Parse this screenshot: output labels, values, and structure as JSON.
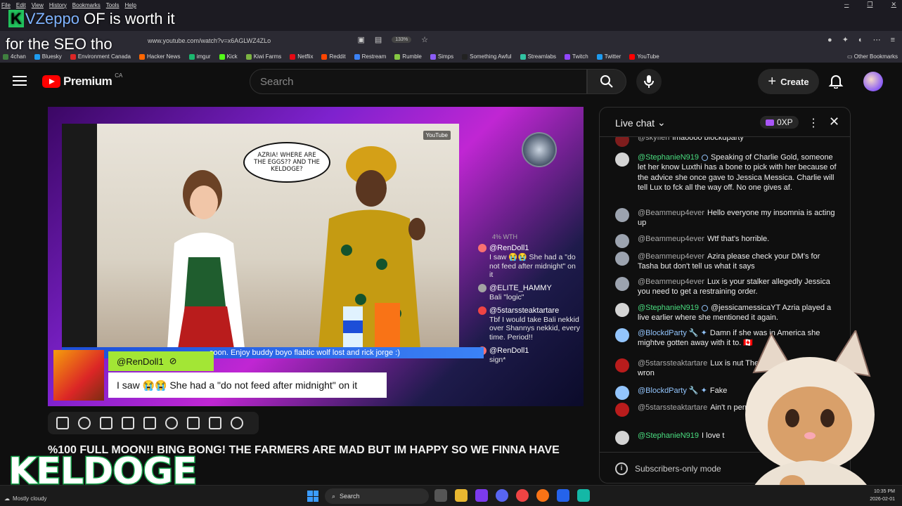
{
  "browser": {
    "menu": [
      "File",
      "Edit",
      "View",
      "History",
      "Bookmarks",
      "Tools",
      "Help"
    ],
    "url": "www.youtube.com/watch?v=x6AGLWZ4ZLo",
    "zoom": "133%",
    "bookmarks": [
      {
        "label": "4chan",
        "color": "#3f7f3f"
      },
      {
        "label": "Bluesky",
        "color": "#1d9bf0"
      },
      {
        "label": "Environment Canada",
        "color": "#dc2626"
      },
      {
        "label": "Hacker News",
        "color": "#ff6600"
      },
      {
        "label": "imgur",
        "color": "#1bb76e"
      },
      {
        "label": "Kick",
        "color": "#53fc18"
      },
      {
        "label": "Kiwi Farms",
        "color": "#7cb342"
      },
      {
        "label": "Netflix",
        "color": "#e50914"
      },
      {
        "label": "Reddit",
        "color": "#ff4500"
      },
      {
        "label": "Restream",
        "color": "#3b82f6"
      },
      {
        "label": "Rumble",
        "color": "#85c742"
      },
      {
        "label": "Simps",
        "color": "#8b5cf6"
      },
      {
        "label": "Something Awful",
        "color": "#222222"
      },
      {
        "label": "Streamlabs",
        "color": "#31c3a2"
      },
      {
        "label": "Twitch",
        "color": "#9146ff"
      },
      {
        "label": "Twitter",
        "color": "#1d9bf0"
      },
      {
        "label": "YouTube",
        "color": "#ff0000"
      }
    ],
    "other_bookmarks": "Other Bookmarks"
  },
  "overlay": {
    "line1_brand": "VZeppo",
    "line1_rest": "OF is worth it",
    "line2": "for the SEO tho",
    "keldoge": "KELDOGE"
  },
  "header": {
    "brand": "Premium",
    "region": "CA",
    "search_placeholder": "Search",
    "create_label": "Create"
  },
  "video": {
    "bubble": "AZRIA! WHERE ARE THE EGGS?? AND THE KELDOGE?",
    "watermark": "YouTube",
    "ticker": "soon. Enjoy buddy boyo flabtic wolf lost and rick jorge :)",
    "alert_user": "@RenDoll1",
    "alert_message": "I saw 😭😭 She had a \"do not feed after midnight\" on it",
    "stream_chat_header": "4% WTH",
    "stream_chat": [
      {
        "user": "@RenDoll1",
        "text": "I saw 😭😭 She had a \"do not feed after midnight\" on it",
        "color": "#f87171"
      },
      {
        "user": "@ELITE_HAMMY",
        "text": "Bali \"logic\"",
        "color": "#a3a3a3"
      },
      {
        "user": "@5starssteaktartare",
        "text": "Tbf I would take Bali nekkid over Shannys nekkid, every time. Period!!",
        "color": "#ef4444"
      },
      {
        "user": "@RenDoll1",
        "text": "sign*",
        "color": "#f87171"
      }
    ],
    "title": "%100 FULL MOON!! BING BONG! THE FARMERS ARE MAD BUT IM HAPPY SO WE FINNA HAVE"
  },
  "chat": {
    "title": "Live chat",
    "xp": "0XP",
    "footer": "Subscribers-only mode",
    "messages": [
      {
        "user": "@skyfleñ",
        "text": "lmaoooo blockdparty",
        "color": "gray",
        "avatar": "#7f1d1d"
      },
      {
        "user": "@StephanieN919",
        "text": "Speaking of Charlie Gold, someone let her know Luxthi has a bone to pick with her because of the advice she once gave to Jessica Messica. Charlie will tell Lux to fck all the way off. No one gives af.",
        "color": "green",
        "avatar": "#d4d4d4",
        "badge": true
      },
      {
        "user": "@Beammeup4ever",
        "text": "Hello everyone my insomnia is acting up",
        "color": "gray",
        "avatar": "#9ca3af"
      },
      {
        "user": "@Beammeup4ever",
        "text": "Wtf that's horrible.",
        "color": "gray",
        "avatar": "#9ca3af"
      },
      {
        "user": "@Beammeup4ever",
        "text": "Azira please check your DM's for Tasha but don't tell us what it says",
        "color": "gray",
        "avatar": "#9ca3af"
      },
      {
        "user": "@Beammeup4ever",
        "text": "Lux is your stalker allegedly Jessica you need to get a restraining order.",
        "color": "gray",
        "avatar": "#9ca3af"
      },
      {
        "user": "@StephanieN919",
        "text": "@jessicamessicaYT Azria played a live earlier where she mentioned it again.",
        "color": "green",
        "avatar": "#d4d4d4",
        "badge": true
      },
      {
        "user": "@BlockdParty 🔧 ✦",
        "text": "Damn if she was in America she mightve gotten away with it to. 🇨🇦",
        "color": "blue",
        "avatar": "#93c5fd"
      },
      {
        "user": "@5starssteaktartare",
        "text": "Lux is nut There is just something wron",
        "color": "gray",
        "avatar": "#b91c1c"
      },
      {
        "user": "@BlockdParty 🔧 ✦",
        "text": "Fake",
        "color": "blue",
        "avatar": "#93c5fd"
      },
      {
        "user": "@5starssteaktartare",
        "text": "Ain't n permanent disability",
        "color": "gray",
        "avatar": "#b91c1c"
      },
      {
        "user": "@StephanieN919",
        "text": "I love t",
        "color": "green",
        "avatar": "#d4d4d4"
      }
    ]
  },
  "taskbar": {
    "weather": "Mostly cloudy",
    "search": "Search",
    "time": "10:35 PM",
    "date": "2026-02-01"
  }
}
